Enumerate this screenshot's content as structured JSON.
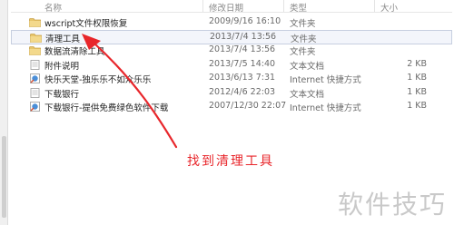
{
  "header": {
    "columns": [
      {
        "key": "name",
        "label": "名称"
      },
      {
        "key": "date",
        "label": "修改日期"
      },
      {
        "key": "type",
        "label": "类型"
      },
      {
        "key": "size",
        "label": "大小"
      }
    ]
  },
  "files": [
    {
      "icon": "folder-icon",
      "name": "wscript文件权限恢复",
      "date": "2009/9/16 16:10",
      "type": "文件夹",
      "size": "",
      "selected": false
    },
    {
      "icon": "folder-icon",
      "name": "清理工具",
      "date": "2013/7/4 13:56",
      "type": "文件夹",
      "size": "",
      "selected": true
    },
    {
      "icon": "folder-icon",
      "name": "数据流清除工具",
      "date": "2013/7/4 13:56",
      "type": "文件夹",
      "size": "",
      "selected": false
    },
    {
      "icon": "text-file-icon",
      "name": "附件说明",
      "date": "2013/7/5 14:40",
      "type": "文本文档",
      "size": "2 KB",
      "selected": false
    },
    {
      "icon": "internet-shortcut-icon",
      "name": "快乐天堂-独乐乐不如众乐乐",
      "date": "2013/6/13 7:31",
      "type": "Internet 快捷方式",
      "size": "1 KB",
      "selected": false
    },
    {
      "icon": "text-file-icon",
      "name": "下载银行",
      "date": "2012/4/6 22:03",
      "type": "文本文档",
      "size": "1 KB",
      "selected": false
    },
    {
      "icon": "internet-shortcut-icon",
      "name": "下载银行-提供免费绿色软件下载",
      "date": "2007/12/30 22:07",
      "type": "Internet 快捷方式",
      "size": "1 KB",
      "selected": false
    }
  ],
  "annotation": {
    "text": "找到清理工具",
    "color": "#e8262b"
  },
  "watermark": {
    "text": "软件技巧"
  }
}
